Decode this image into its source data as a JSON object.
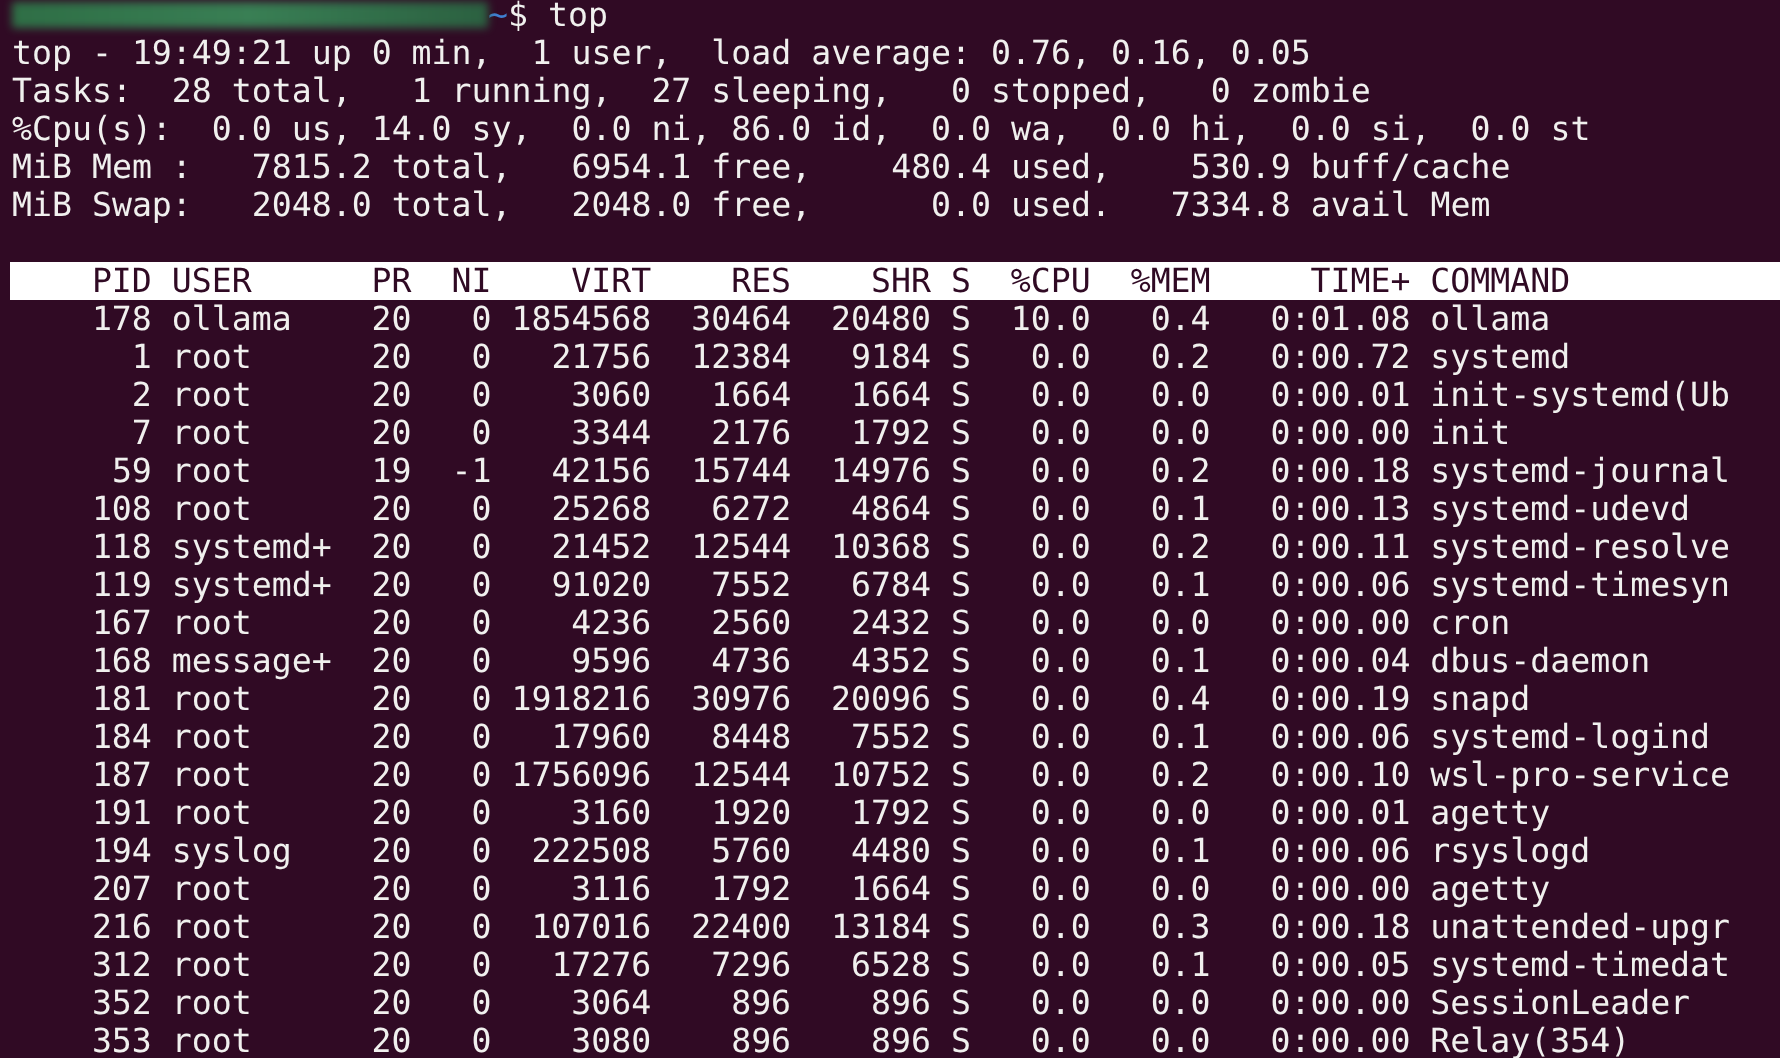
{
  "prompt": {
    "path": "~",
    "command": "$ top"
  },
  "summary": [
    "top - 19:49:21 up 0 min,  1 user,  load average: 0.76, 0.16, 0.05",
    "Tasks:  28 total,   1 running,  27 sleeping,   0 stopped,   0 zombie",
    "%Cpu(s):  0.0 us, 14.0 sy,  0.0 ni, 86.0 id,  0.0 wa,  0.0 hi,  0.0 si,  0.0 st",
    "MiB Mem :   7815.2 total,   6954.1 free,    480.4 used,    530.9 buff/cache",
    "MiB Swap:   2048.0 total,   2048.0 free,      0.0 used.   7334.8 avail Mem"
  ],
  "table": {
    "columns": [
      "PID",
      "USER",
      "PR",
      "NI",
      "VIRT",
      "RES",
      "SHR",
      "S",
      "%CPU",
      "%MEM",
      "TIME+",
      "COMMAND"
    ],
    "rows": [
      [
        "178",
        "ollama",
        "20",
        "0",
        "1854568",
        "30464",
        "20480",
        "S",
        "10.0",
        "0.4",
        "0:01.08",
        "ollama"
      ],
      [
        "1",
        "root",
        "20",
        "0",
        "21756",
        "12384",
        "9184",
        "S",
        "0.0",
        "0.2",
        "0:00.72",
        "systemd"
      ],
      [
        "2",
        "root",
        "20",
        "0",
        "3060",
        "1664",
        "1664",
        "S",
        "0.0",
        "0.0",
        "0:00.01",
        "init-systemd(Ub"
      ],
      [
        "7",
        "root",
        "20",
        "0",
        "3344",
        "2176",
        "1792",
        "S",
        "0.0",
        "0.0",
        "0:00.00",
        "init"
      ],
      [
        "59",
        "root",
        "19",
        "-1",
        "42156",
        "15744",
        "14976",
        "S",
        "0.0",
        "0.2",
        "0:00.18",
        "systemd-journal"
      ],
      [
        "108",
        "root",
        "20",
        "0",
        "25268",
        "6272",
        "4864",
        "S",
        "0.0",
        "0.1",
        "0:00.13",
        "systemd-udevd"
      ],
      [
        "118",
        "systemd+",
        "20",
        "0",
        "21452",
        "12544",
        "10368",
        "S",
        "0.0",
        "0.2",
        "0:00.11",
        "systemd-resolve"
      ],
      [
        "119",
        "systemd+",
        "20",
        "0",
        "91020",
        "7552",
        "6784",
        "S",
        "0.0",
        "0.1",
        "0:00.06",
        "systemd-timesyn"
      ],
      [
        "167",
        "root",
        "20",
        "0",
        "4236",
        "2560",
        "2432",
        "S",
        "0.0",
        "0.0",
        "0:00.00",
        "cron"
      ],
      [
        "168",
        "message+",
        "20",
        "0",
        "9596",
        "4736",
        "4352",
        "S",
        "0.0",
        "0.1",
        "0:00.04",
        "dbus-daemon"
      ],
      [
        "181",
        "root",
        "20",
        "0",
        "1918216",
        "30976",
        "20096",
        "S",
        "0.0",
        "0.4",
        "0:00.19",
        "snapd"
      ],
      [
        "184",
        "root",
        "20",
        "0",
        "17960",
        "8448",
        "7552",
        "S",
        "0.0",
        "0.1",
        "0:00.06",
        "systemd-logind"
      ],
      [
        "187",
        "root",
        "20",
        "0",
        "1756096",
        "12544",
        "10752",
        "S",
        "0.0",
        "0.2",
        "0:00.10",
        "wsl-pro-service"
      ],
      [
        "191",
        "root",
        "20",
        "0",
        "3160",
        "1920",
        "1792",
        "S",
        "0.0",
        "0.0",
        "0:00.01",
        "agetty"
      ],
      [
        "194",
        "syslog",
        "20",
        "0",
        "222508",
        "5760",
        "4480",
        "S",
        "0.0",
        "0.1",
        "0:00.06",
        "rsyslogd"
      ],
      [
        "207",
        "root",
        "20",
        "0",
        "3116",
        "1792",
        "1664",
        "S",
        "0.0",
        "0.0",
        "0:00.00",
        "agetty"
      ],
      [
        "216",
        "root",
        "20",
        "0",
        "107016",
        "22400",
        "13184",
        "S",
        "0.0",
        "0.3",
        "0:00.18",
        "unattended-upgr"
      ],
      [
        "312",
        "root",
        "20",
        "0",
        "17276",
        "7296",
        "6528",
        "S",
        "0.0",
        "0.1",
        "0:00.05",
        "systemd-timedat"
      ],
      [
        "352",
        "root",
        "20",
        "0",
        "3064",
        "896",
        "896",
        "S",
        "0.0",
        "0.0",
        "0:00.00",
        "SessionLeader"
      ],
      [
        "353",
        "root",
        "20",
        "0",
        "3080",
        "896",
        "896",
        "S",
        "0.0",
        "0.0",
        "0:00.00",
        "Relay(354)"
      ]
    ]
  }
}
